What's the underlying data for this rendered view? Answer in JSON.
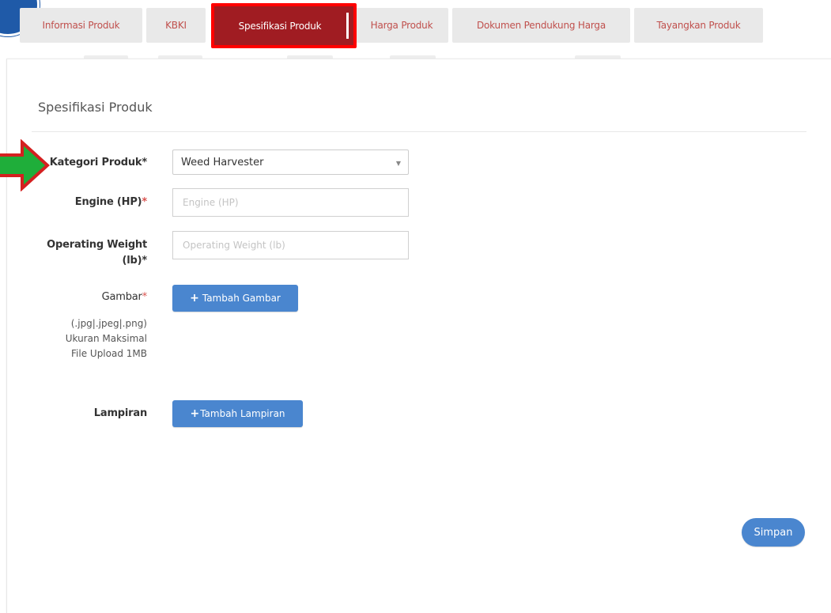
{
  "tabs": [
    {
      "label": "Informasi Produk"
    },
    {
      "label": "KBKI"
    },
    {
      "label": "Spesifikasi Produk",
      "active": true
    },
    {
      "label": "Harga Produk"
    },
    {
      "label": "Dokumen Pendukung Harga"
    },
    {
      "label": "Tayangkan Produk"
    }
  ],
  "section": {
    "title": "Spesifikasi Produk"
  },
  "form": {
    "kategori": {
      "label": "Kategori Produk",
      "required_mark": "*",
      "selected": "Weed Harvester"
    },
    "engine": {
      "label": "Engine (HP)",
      "required_mark": "*",
      "placeholder": "Engine (HP)",
      "value": ""
    },
    "weight": {
      "label_line1": "Operating Weight",
      "label_line2": "(lb)",
      "required_mark": "*",
      "placeholder": "Operating Weight (lb)",
      "value": ""
    },
    "gambar": {
      "label": "Gambar",
      "required_mark": "*",
      "hint_lines": [
        "(.jpg|.jpeg|.png)",
        "Ukuran Maksimal",
        "File Upload 1MB"
      ],
      "button_label": "Tambah Gambar",
      "button_plus": "+"
    },
    "lampiran": {
      "label": "Lampiran",
      "button_label": "Tambah Lampiran",
      "button_plus": "+"
    }
  },
  "actions": {
    "save_label": "Simpan"
  },
  "colors": {
    "active_tab_bg": "#a01c22",
    "highlight_border": "#ff0000",
    "tab_text": "#c0504d",
    "button_blue": "#4a86cf",
    "arrow_green": "#1fae3a",
    "arrow_outline": "#d42020"
  },
  "icons": {
    "annotation_arrow": "arrow-right-icon",
    "caret": "caret-down-icon",
    "plus": "plus-icon"
  }
}
